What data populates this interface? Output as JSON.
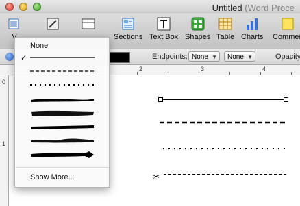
{
  "window": {
    "title": "Untitled",
    "title_suffix": "(Word Proce"
  },
  "toolbar": {
    "items": [
      {
        "label": "V",
        "icon": "view-icon"
      },
      {
        "label": "",
        "icon": "edit-icon"
      },
      {
        "label": "",
        "icon": "table-edit-icon"
      },
      {
        "label": "Sections",
        "icon": "sections-icon"
      },
      {
        "label": "Text Box",
        "icon": "text-box-icon"
      },
      {
        "label": "Shapes",
        "icon": "shapes-icon"
      },
      {
        "label": "Table",
        "icon": "table-icon"
      },
      {
        "label": "Charts",
        "icon": "charts-icon"
      },
      {
        "label": "Commen",
        "icon": "comment-icon"
      }
    ]
  },
  "format_bar": {
    "endpoints_label": "Endpoints:",
    "endpoint_left": "None",
    "endpoint_right": "None",
    "opacity_label": "Opacity"
  },
  "ruler": {
    "marks": [
      "2",
      "3",
      "4"
    ],
    "vertical_marks": [
      "0",
      "1"
    ]
  },
  "line_style_menu": {
    "none_label": "None",
    "selected_index": 0,
    "styles": [
      {
        "name": "solid-thin"
      },
      {
        "name": "dashed"
      },
      {
        "name": "dotted"
      },
      {
        "name": "brush-1"
      },
      {
        "name": "brush-2"
      },
      {
        "name": "brush-3"
      },
      {
        "name": "brush-4"
      },
      {
        "name": "brush-arrow"
      }
    ],
    "show_more_label": "Show More..."
  },
  "colors": {
    "stroke_color": "#000000",
    "handle_fill": "#ffffff"
  }
}
